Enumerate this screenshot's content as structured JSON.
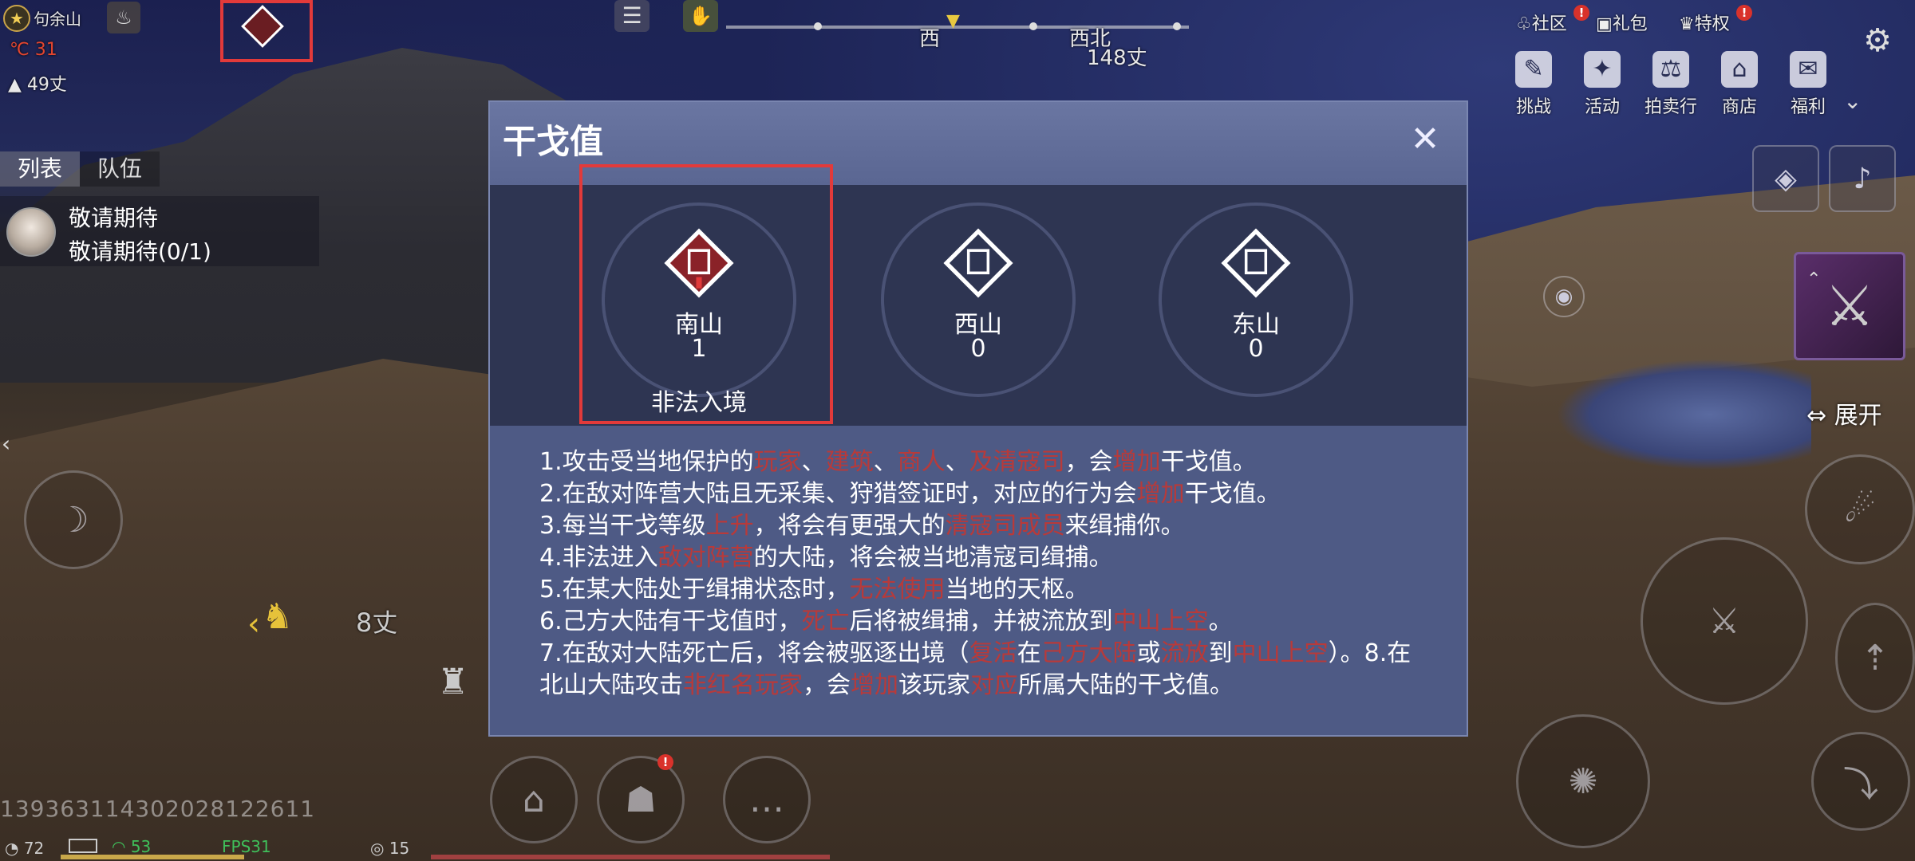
{
  "hud": {
    "location": "句余山",
    "temperature": "31",
    "elevation": "49丈",
    "tabs": [
      "列表",
      "队伍"
    ],
    "quest_title": "敬请期待",
    "quest_progress": "敬请期待(0/1)",
    "compass": {
      "west": "西",
      "northwest": "西北",
      "distance": "148丈"
    },
    "marker_distance": "8丈",
    "player_id": "1393631143020281226​11",
    "status_bar": {
      "ping": "72",
      "signal": "53",
      "fps": "FPS31",
      "extra": "15"
    },
    "expand": "展开"
  },
  "top_links": [
    {
      "label": "社区",
      "badge": "!"
    },
    {
      "label": "礼包"
    },
    {
      "label": "特权",
      "badge": "!"
    }
  ],
  "menu": [
    {
      "label": "挑战",
      "icon": "challenge-icon"
    },
    {
      "label": "活动",
      "icon": "activity-icon"
    },
    {
      "label": "拍卖行",
      "icon": "auction-icon"
    },
    {
      "label": "商店",
      "icon": "shop-icon"
    },
    {
      "label": "福利",
      "icon": "welfare-icon"
    }
  ],
  "modal": {
    "title": "干戈值",
    "regions": [
      {
        "name": "南山",
        "value": "1",
        "status": "非法入境"
      },
      {
        "name": "西山",
        "value": "0"
      },
      {
        "name": "东山",
        "value": "0"
      }
    ],
    "rules": [
      [
        {
          "t": "1.攻击受当地保护的"
        },
        {
          "t": "玩家",
          "hl": true
        },
        {
          "t": "、"
        },
        {
          "t": "建筑",
          "hl": true
        },
        {
          "t": "、"
        },
        {
          "t": "商人",
          "hl": true
        },
        {
          "t": "、"
        },
        {
          "t": "及清寇司",
          "hl": true
        },
        {
          "t": "，会"
        },
        {
          "t": "增加",
          "hl": true
        },
        {
          "t": "干戈值。"
        }
      ],
      [
        {
          "t": "2.在敌对阵营大陆且无采集、狩猎签证时，对应的行为会"
        },
        {
          "t": "增加",
          "hl": true
        },
        {
          "t": "干戈值。"
        }
      ],
      [
        {
          "t": "3.每当干戈等级"
        },
        {
          "t": "上升",
          "hl": true
        },
        {
          "t": "，将会有更强大的"
        },
        {
          "t": "清寇司成员",
          "hl": true
        },
        {
          "t": "来缉捕你。"
        }
      ],
      [
        {
          "t": "4.非法进入"
        },
        {
          "t": "敌对阵营",
          "hl": true
        },
        {
          "t": "的大陆，将会被当地清寇司缉捕。"
        }
      ],
      [
        {
          "t": "5.在某大陆处于缉捕状态时，"
        },
        {
          "t": "无法使用",
          "hl": true
        },
        {
          "t": "当地的天枢。"
        }
      ],
      [
        {
          "t": "6.己方大陆有干戈值时，"
        },
        {
          "t": "死亡",
          "hl": true
        },
        {
          "t": "后将被缉捕，并被流放到"
        },
        {
          "t": "中山上空",
          "hl": true
        },
        {
          "t": "。"
        }
      ],
      [
        {
          "t": "7.在敌对大陆死亡后，将会被驱逐出境（"
        },
        {
          "t": "复活",
          "hl": true
        },
        {
          "t": "在"
        },
        {
          "t": "己方大陆",
          "hl": true
        },
        {
          "t": "或"
        },
        {
          "t": "流放",
          "hl": true
        },
        {
          "t": "到"
        },
        {
          "t": "中山上空",
          "hl": true
        },
        {
          "t": "）。8.在北山大陆攻击"
        },
        {
          "t": "非红名玩家",
          "hl": true
        },
        {
          "t": "，会"
        },
        {
          "t": "增加",
          "hl": true
        },
        {
          "t": "该玩家"
        },
        {
          "t": "对应",
          "hl": true
        },
        {
          "t": "所属大陆的干戈值。"
        }
      ]
    ]
  },
  "colors": {
    "modal_bg": "#4e5a85",
    "band_bg": "#2e3552",
    "highlight_red": "#b83a3a",
    "box_red": "#e23a3a"
  }
}
